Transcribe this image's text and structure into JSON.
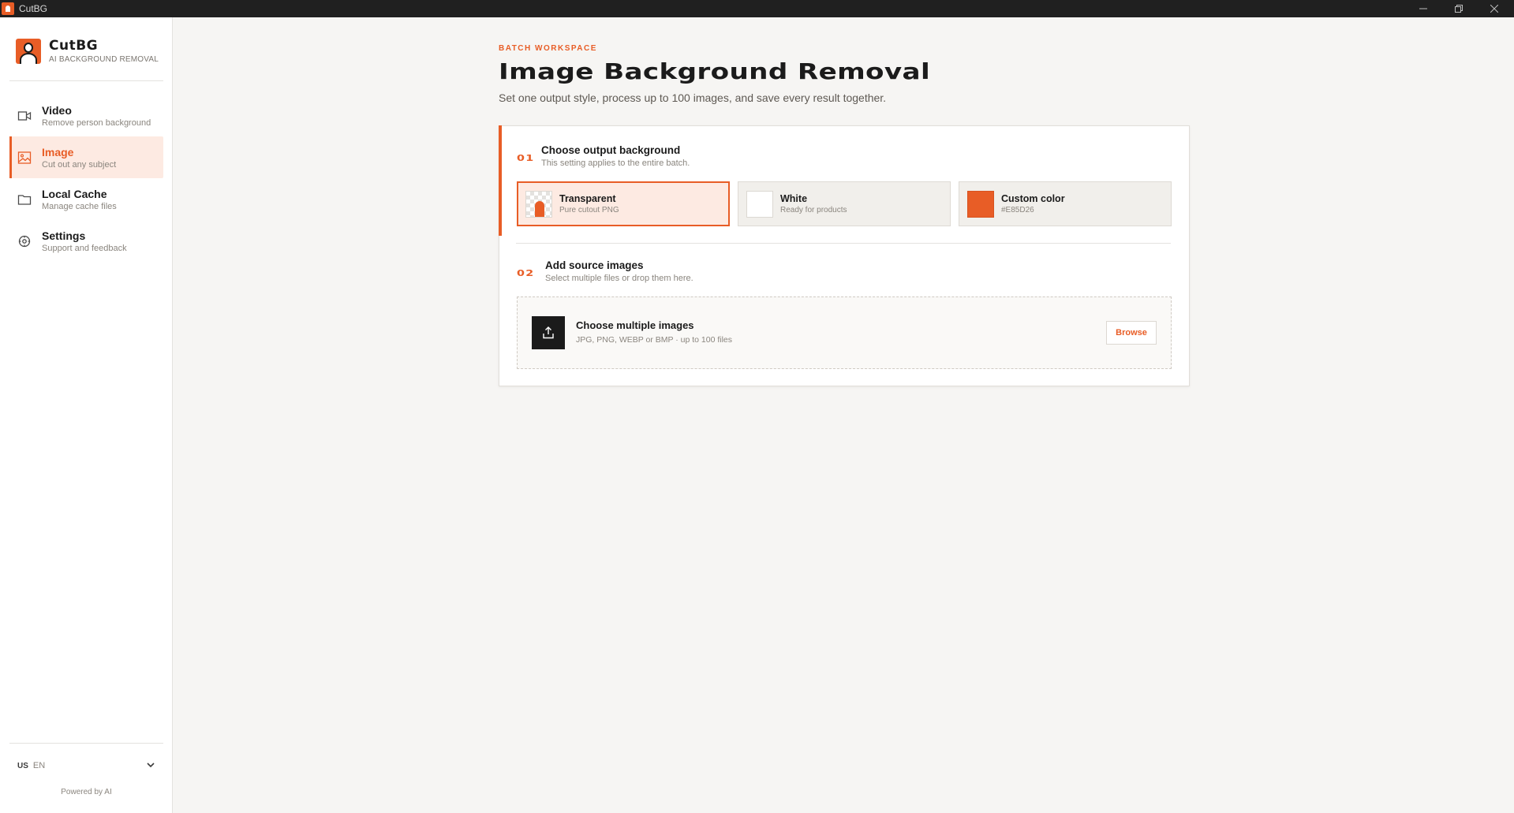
{
  "window": {
    "title": "CutBG"
  },
  "brand": {
    "name": "CutBG",
    "subtitle": "AI BACKGROUND REMOVAL"
  },
  "sidebar": {
    "items": [
      {
        "label": "Video",
        "sub": "Remove person background",
        "icon": "video-icon"
      },
      {
        "label": "Image",
        "sub": "Cut out any subject",
        "icon": "image-icon",
        "active": true
      },
      {
        "label": "Local Cache",
        "sub": "Manage cache files",
        "icon": "folder-icon"
      },
      {
        "label": "Settings",
        "sub": "Support and feedback",
        "icon": "settings-icon"
      }
    ],
    "language": {
      "code": "US",
      "name": "EN"
    },
    "powered_by": "Powered by AI"
  },
  "main": {
    "kicker": "BATCH WORKSPACE",
    "title": "Image Background Removal",
    "subtitle": "Set one output style, process up to 100 images, and save every result together.",
    "step1": {
      "num": "01",
      "title": "Choose output background",
      "sub": "This setting applies to the entire batch.",
      "options": [
        {
          "label": "Transparent",
          "sub": "Pure cutout PNG",
          "selected": true
        },
        {
          "label": "White",
          "sub": "Ready for products"
        },
        {
          "label": "Custom color",
          "sub": "#E85D26"
        }
      ]
    },
    "step2": {
      "num": "02",
      "title": "Add source images",
      "sub": "Select multiple files or drop them here.",
      "dropzone_title": "Choose multiple images",
      "dropzone_sub": "JPG, PNG, WEBP or BMP · up to 100 files",
      "browse_label": "Browse"
    }
  },
  "colors": {
    "accent": "#E85D26",
    "accent_soft": "#FDEAE2",
    "background": "#F6F5F3",
    "dark": "#1B1B1B"
  }
}
